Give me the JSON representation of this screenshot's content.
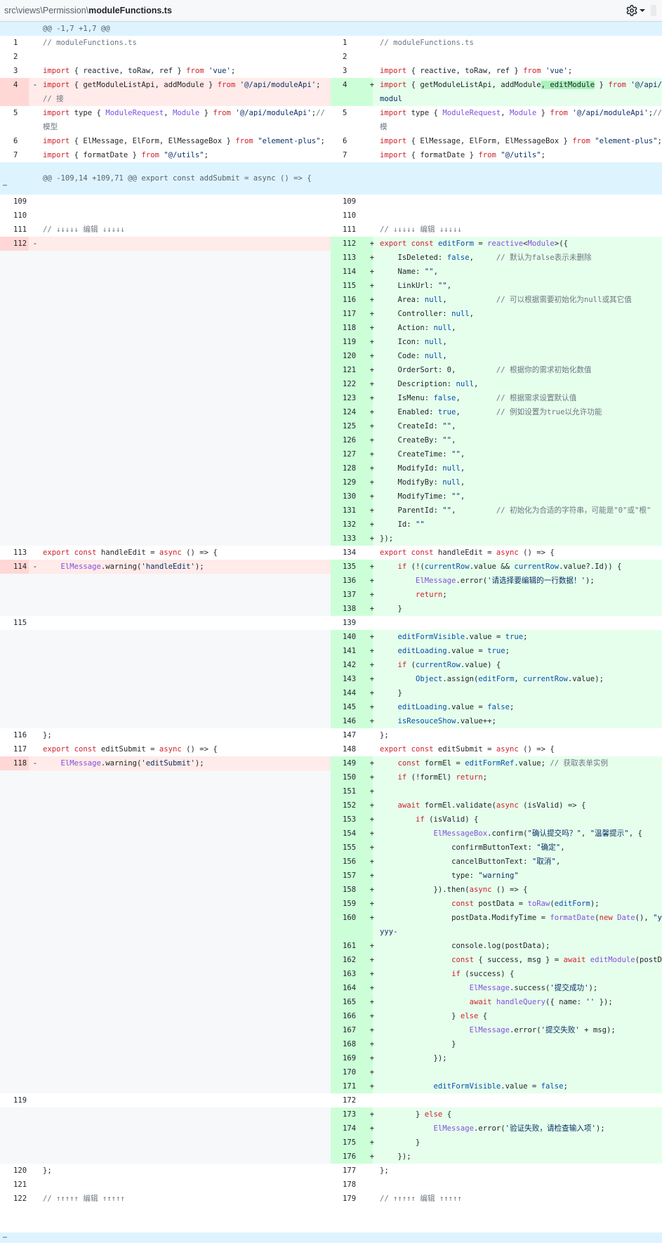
{
  "file_header": {
    "path_prefix": "src\\views\\Permission\\",
    "file_name": "moduleFunctions.ts",
    "settings_icon": "gear-icon",
    "dropdown_icon": "chevron-down-icon"
  },
  "hunks": {
    "first": "@@ -1,7 +1,7 @@",
    "second": "@@ -109,14 +109,71 @@ export const addSubmit = async () => {"
  },
  "expand_icons": {
    "down": "⇣",
    "up": "⇡",
    "dots": "⋯"
  },
  "colors": {
    "deleted_line": "#ffebe9",
    "added_line": "#e6ffec",
    "hunk_header": "#ddf4ff"
  }
}
